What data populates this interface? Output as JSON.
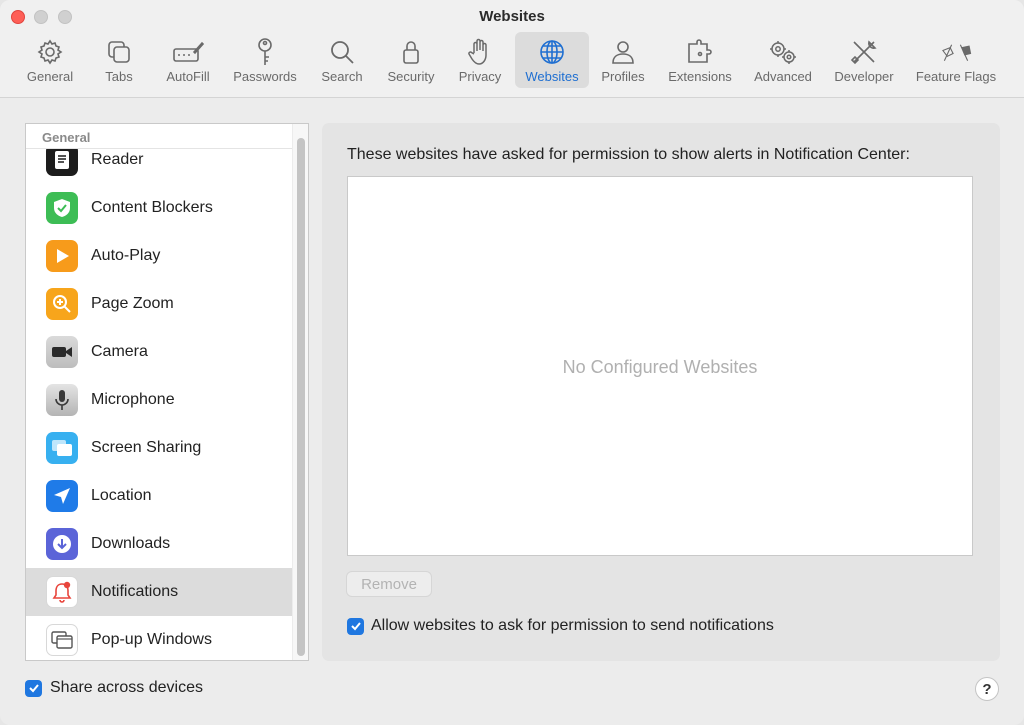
{
  "window": {
    "title": "Websites"
  },
  "toolbar": {
    "items": [
      {
        "label": "General",
        "icon": "gear-icon"
      },
      {
        "label": "Tabs",
        "icon": "tabs-icon"
      },
      {
        "label": "AutoFill",
        "icon": "autofill-icon"
      },
      {
        "label": "Passwords",
        "icon": "key-icon"
      },
      {
        "label": "Search",
        "icon": "search-icon"
      },
      {
        "label": "Security",
        "icon": "lock-icon"
      },
      {
        "label": "Privacy",
        "icon": "hand-icon"
      },
      {
        "label": "Websites",
        "icon": "globe-icon",
        "active": true
      },
      {
        "label": "Profiles",
        "icon": "person-icon"
      },
      {
        "label": "Extensions",
        "icon": "puzzle-icon"
      },
      {
        "label": "Advanced",
        "icon": "gears-icon"
      },
      {
        "label": "Developer",
        "icon": "tools-icon"
      },
      {
        "label": "Feature Flags",
        "icon": "flags-icon"
      }
    ]
  },
  "sidebar": {
    "header": "General",
    "items": [
      {
        "label": "Reader",
        "icon": "reader-icon",
        "color": "#1c1c1c"
      },
      {
        "label": "Content Blockers",
        "icon": "shield-check-icon",
        "color": "#3dbd55"
      },
      {
        "label": "Auto-Play",
        "icon": "play-icon",
        "color": "#f79b1b"
      },
      {
        "label": "Page Zoom",
        "icon": "zoom-icon",
        "color": "#f7a51b"
      },
      {
        "label": "Camera",
        "icon": "camera-icon",
        "color": "#6d6d6d"
      },
      {
        "label": "Microphone",
        "icon": "microphone-icon",
        "color": "#9a9a9a"
      },
      {
        "label": "Screen Sharing",
        "icon": "screen-sharing-icon",
        "color": "#37b0f0"
      },
      {
        "label": "Location",
        "icon": "location-arrow-icon",
        "color": "#1f7be8"
      },
      {
        "label": "Downloads",
        "icon": "download-icon",
        "color": "#5b64d8"
      },
      {
        "label": "Notifications",
        "icon": "bell-icon",
        "color": "#ffffff",
        "selected": true
      },
      {
        "label": "Pop-up Windows",
        "icon": "popup-windows-icon",
        "color": "#ffffff"
      }
    ]
  },
  "panel": {
    "description": "These websites have asked for permission to show alerts in Notification Center:",
    "empty_text": "No Configured Websites",
    "remove_label": "Remove",
    "allow_label": "Allow websites to ask for permission to send notifications",
    "allow_checked": true
  },
  "footer": {
    "share_label": "Share across devices",
    "share_checked": true,
    "help_label": "?"
  },
  "colors": {
    "accent": "#1f77e0",
    "close": "#fe5f57"
  }
}
